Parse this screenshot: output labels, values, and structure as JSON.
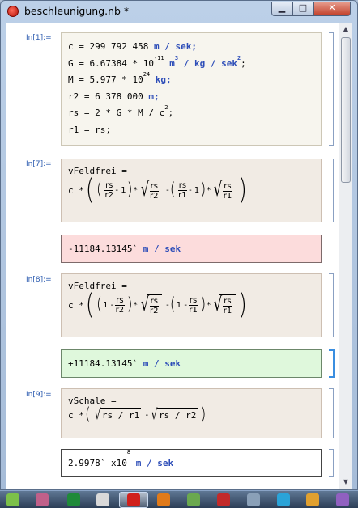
{
  "window": {
    "title": "beschleunigung.nb *",
    "minimize_glyph": "▁",
    "maximize_glyph": "□",
    "close_glyph": "✕"
  },
  "cells": {
    "in1": {
      "label": "In[1]:=",
      "c_def": "c = 299 792 458",
      "c_unit": "m / sek;",
      "g_def": "G = 6.67384 * 10",
      "g_exp": "-11",
      "g_unit_m": "m",
      "g_m_exp": "3",
      "g_unit_rest": "/ kg / sek",
      "g_sek_exp": "2",
      "g_end": ";",
      "m_def": "M = 5.977 * 10",
      "m_exp": "24",
      "m_unit": "kg;",
      "r2_def": "r2 = 6 378 000",
      "r2_unit": "m;",
      "rs_def": "rs = 2 * G * M / c",
      "rs_exp": "2",
      "rs_end": ";",
      "r1_def": "r1 = rs;"
    },
    "in7": {
      "label": "In[7]:=",
      "name": "vFeldfrei =",
      "expr_lead": "c *"
    },
    "out7": {
      "value": "-11184.13145`",
      "unit": "m / sek"
    },
    "in8": {
      "label": "In[8]:=",
      "name": "vFeldfrei =",
      "expr_lead": "c *"
    },
    "out8": {
      "value": "+11184.13145`",
      "unit": "m / sek"
    },
    "in9": {
      "label": "In[9]:=",
      "name": "vSchale =",
      "expr_lead": "c *",
      "rad1": "rs / r1",
      "rad2": "rs / r2"
    },
    "out9": {
      "mantissa": "2.9978` x10",
      "exp": "8",
      "unit": "m / sek"
    }
  },
  "math_tokens": {
    "rs": "rs",
    "r1": "r1",
    "r2": "r2",
    "one": "1",
    "minus": "-",
    "times": "*"
  },
  "taskbar": {
    "icons": [
      "play-icon",
      "flask-icon",
      "excel-icon",
      "calculator-icon",
      "mathematica-icon",
      "matlab-icon",
      "puzzle-icon",
      "tool-icon",
      "network-icon",
      "triangle-app-icon",
      "globe-icon",
      "monitor-icon"
    ],
    "colors": {
      "play-icon": "#7cc04a",
      "flask-icon": "#c0608a",
      "excel-icon": "#1f8a3a",
      "calculator-icon": "#d9d9d9",
      "mathematica-icon": "#d0201c",
      "matlab-icon": "#e07a1a",
      "puzzle-icon": "#6aa84f",
      "tool-icon": "#c22a2a",
      "network-icon": "#8aa0b8",
      "triangle-app-icon": "#2aa3d8",
      "globe-icon": "#e0a030",
      "monitor-icon": "#9060c0"
    }
  }
}
